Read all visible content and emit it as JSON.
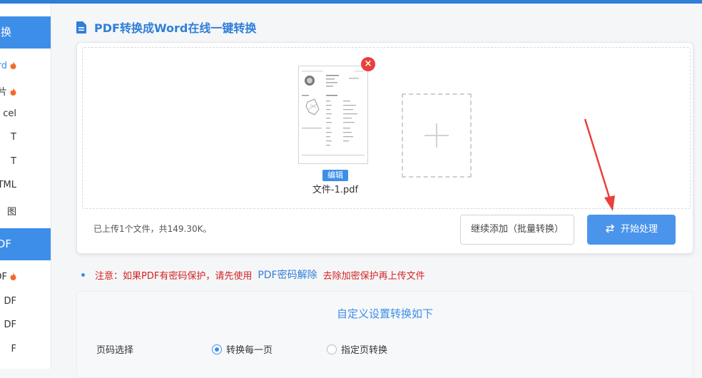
{
  "sidebar": {
    "sections": [
      {
        "label": "换"
      },
      {
        "label": "PDF"
      }
    ],
    "items": [
      {
        "label": "ord",
        "hot": true,
        "active": true
      },
      {
        "label": "片",
        "hot": true,
        "active": false
      },
      {
        "label": "cel",
        "hot": false,
        "active": false
      },
      {
        "label": "T",
        "hot": false,
        "active": false
      },
      {
        "label": "T",
        "hot": false,
        "active": false
      },
      {
        "label": "TML",
        "hot": false,
        "active": false
      },
      {
        "label": "图",
        "hot": false,
        "active": false
      },
      {
        "label": "PDF",
        "hot": true,
        "active": false
      },
      {
        "label": "DF",
        "hot": false,
        "active": false
      },
      {
        "label": "DF",
        "hot": false,
        "active": false
      },
      {
        "label": "F",
        "hot": false,
        "active": false
      }
    ]
  },
  "page": {
    "title": "PDF转换成Word在线一键转换"
  },
  "upload": {
    "file_name": "文件-1.pdf",
    "edit_label": "编辑",
    "remove_symbol": "×",
    "status": "已上传1个文件，共149.30K。",
    "continue_button": "继续添加（批量转换）",
    "start_button": "开始处理"
  },
  "notice": {
    "prefix": "注意：如果PDF有密码保护，请先使用",
    "link": "PDF密码解除",
    "suffix": "去除加密保护再上传文件"
  },
  "settings": {
    "title": "自定义设置转换如下",
    "page_select_label": "页码选择",
    "options": [
      {
        "label": "转换每一页",
        "selected": true
      },
      {
        "label": "指定页转换",
        "selected": false
      }
    ]
  },
  "colors": {
    "accent": "#3d8ee8",
    "danger": "#e8413c",
    "arrow": "#e8413c"
  }
}
